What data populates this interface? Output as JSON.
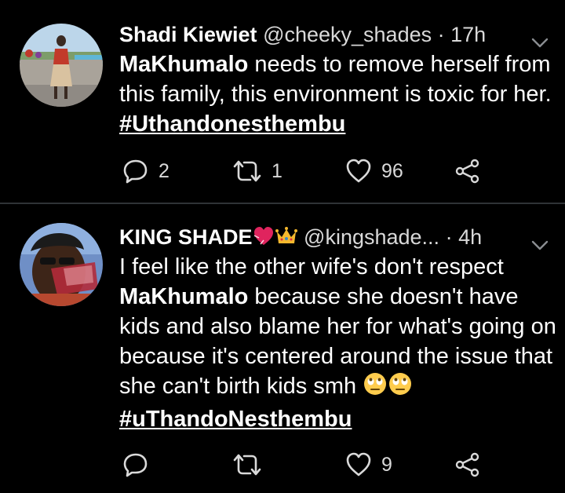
{
  "tweets": [
    {
      "author_name": "Shadi Kiewiet",
      "handle": "@cheeky_shades",
      "separator": "·",
      "time": "17h",
      "body_mention": "MaKhumalo",
      "body_line": " needs to remove herself from this family, this environment is toxic for her. ",
      "body_hashtag": "#Uthandonesthembu",
      "replies": "2",
      "retweets": "1",
      "likes": "96"
    },
    {
      "author_name": "KING SHADE",
      "author_emojis": [
        "heart-icon",
        "crown-icon"
      ],
      "handle": "@kingshade...",
      "separator": "·",
      "time": "4h",
      "body_start": "I feel like the other wife's don't respect ",
      "body_mention": "MaKhumalo",
      "body_rest": " because she doesn't have kids and also blame her for what's going on because it's centered around the issue that she can't birth kids smh ",
      "body_emojis": [
        "rolling-eyes-icon",
        "rolling-eyes-icon"
      ],
      "body_hashtag": "#uThandoNesthembu",
      "replies": "",
      "retweets": "",
      "likes": "9"
    }
  ],
  "icons": {
    "reply": "reply-icon",
    "retweet": "retweet-icon",
    "like": "like-icon",
    "share": "share-icon",
    "more": "chevron-down-icon"
  },
  "colors": {
    "background": "#000000",
    "text": "#ffffff",
    "secondary": "#d9d9d9",
    "divider": "#2f3336"
  }
}
